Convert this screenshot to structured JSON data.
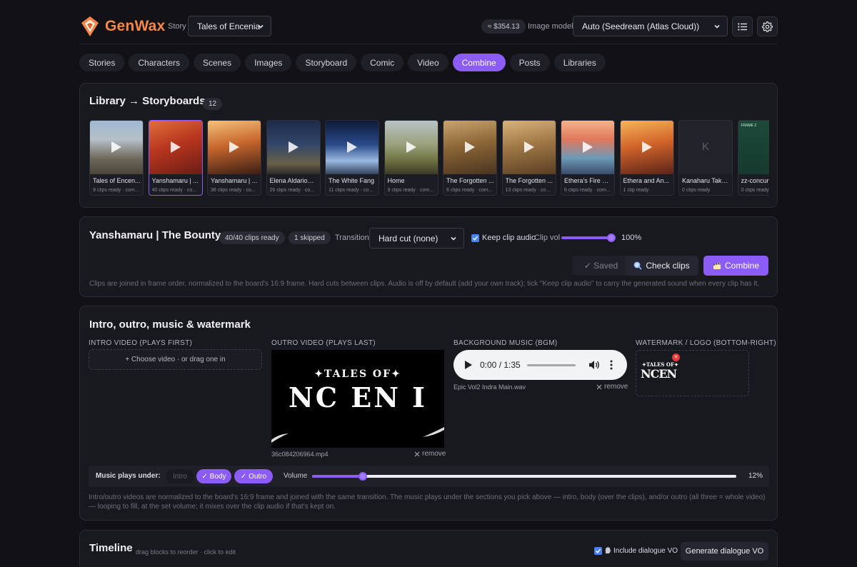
{
  "header": {
    "brand": "GenWax",
    "story_label": "Story",
    "story_value": "Tales of Encenia",
    "balance": "≈ $354.13",
    "model_label": "Image model",
    "model_value": "Auto (Seedream (Atlas Cloud))"
  },
  "tabs": [
    "Stories",
    "Characters",
    "Scenes",
    "Images",
    "Storyboard",
    "Comic",
    "Video",
    "Combine",
    "Posts",
    "Libraries"
  ],
  "active_tab": "Combine",
  "library": {
    "title": "Library → Storyboards",
    "count": "12",
    "items": [
      {
        "title": "Tales of Encen...",
        "sub": "9 clips ready · com..."
      },
      {
        "title": "Yanshamaru | ...",
        "sub": "40 clips ready · co..."
      },
      {
        "title": "Yanshamaru | ...",
        "sub": "36 clips ready · co..."
      },
      {
        "title": "Elena Aldarion ...",
        "sub": "26 clips ready · co..."
      },
      {
        "title": "The White Fang",
        "sub": "11 clips ready · co..."
      },
      {
        "title": "Home",
        "sub": "9 clips ready · com..."
      },
      {
        "title": "The Forgotten ...",
        "sub": "6 clips ready · com..."
      },
      {
        "title": "The Forgotten ...",
        "sub": "13 clips ready · co..."
      },
      {
        "title": "Ethera's Fire —...",
        "sub": "6 clips ready · com..."
      },
      {
        "title": "Ethera and An...",
        "sub": "1 clip ready"
      },
      {
        "title": "Kanaharu Take...",
        "sub": "0 clips ready",
        "placeholder": "K"
      },
      {
        "title": "zz-concur",
        "sub": "0 clips ready",
        "frame_label": "FRAME 2"
      }
    ]
  },
  "board": {
    "title": "Yanshamaru | The Bounty",
    "ready": "40/40 clips ready",
    "skipped": "1 skipped",
    "transition_label": "Transition",
    "transition_value": "Hard cut (none)",
    "keep_audio_label": "Keep clip audio",
    "clip_vol_label": "Clip vol",
    "clip_vol_value": "100%",
    "clip_vol_fraction": 1.0,
    "saved_label": "✓ Saved",
    "check_label": "Check clips",
    "combine_label": "Combine",
    "hint": "Clips are joined in frame order, normalized to the board's 16:9 frame. Hard cuts between clips. Audio is off by default (add your own track); tick \"Keep clip audio\" to carry the generated sound when every clip has it."
  },
  "intro": {
    "title": "Intro, outro, music & watermark",
    "intro_label": "INTRO VIDEO (PLAYS FIRST)",
    "intro_drop": "+ Choose video · or drag one in",
    "outro_label": "OUTRO VIDEO (PLAYS LAST)",
    "outro_file": "36c084206964.mp4",
    "outro_title": "✦TALES OF✦",
    "outro_word": "NC EN I",
    "remove_label": "remove",
    "bgm_label": "BACKGROUND MUSIC (BGM)",
    "bgm_time": "0:00 / 1:35",
    "bgm_file": "Epic Vol2 Indra Main.wav",
    "wm_label": "WATERMARK / LOGO (BOTTOM-RIGHT)",
    "wm_top": "✦TALES OF✦",
    "wm_word": "NCEN",
    "music_under_label": "Music plays under:",
    "seg_intro": "Intro",
    "seg_body": "✓ Body",
    "seg_outro": "✓ Outro",
    "volume_label": "Volume",
    "volume_value": "12%",
    "volume_fraction": 0.12,
    "hint": "Intro/outro videos are normalized to the board's 16:9 frame and joined with the same transition. The music plays under the sections you pick above — intro, body (over the clips), and/or outro (all three = whole video) — looping to fill, at the set volume; it mixes over the clip audio if that's kept on."
  },
  "timeline": {
    "title": "Timeline",
    "hint": "drag blocks to reorder · click to edit",
    "include_vo": "Include dialogue VO",
    "generate_vo": "Generate dialogue VO"
  },
  "colors": {
    "accent": "#8b5cf6",
    "brand": "#f4874a",
    "checkbox": "#4a82f0"
  }
}
